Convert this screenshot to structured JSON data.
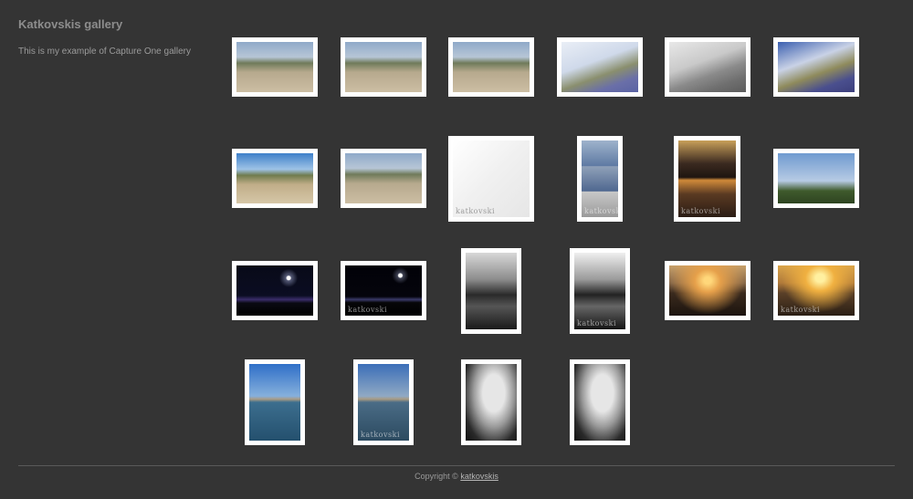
{
  "header": {
    "title": "Katkovskis gallery",
    "description": "This is my example of Capture One gallery"
  },
  "thumbnails": [
    {
      "id": 1,
      "watermark": ""
    },
    {
      "id": 2,
      "watermark": ""
    },
    {
      "id": 3,
      "watermark": ""
    },
    {
      "id": 4,
      "watermark": ""
    },
    {
      "id": 5,
      "watermark": ""
    },
    {
      "id": 6,
      "watermark": ""
    },
    {
      "id": 7,
      "watermark": ""
    },
    {
      "id": 8,
      "watermark": ""
    },
    {
      "id": 9,
      "watermark": "katkovski"
    },
    {
      "id": 10,
      "watermark": "katkovski"
    },
    {
      "id": 11,
      "watermark": "katkovski"
    },
    {
      "id": 12,
      "watermark": ""
    },
    {
      "id": 13,
      "watermark": ""
    },
    {
      "id": 14,
      "watermark": "katkovski"
    },
    {
      "id": 15,
      "watermark": ""
    },
    {
      "id": 16,
      "watermark": "katkovski"
    },
    {
      "id": 17,
      "watermark": ""
    },
    {
      "id": 18,
      "watermark": "katkovski"
    },
    {
      "id": 19,
      "watermark": ""
    },
    {
      "id": 20,
      "watermark": "katkovski"
    },
    {
      "id": 21,
      "watermark": ""
    },
    {
      "id": 22,
      "watermark": ""
    }
  ],
  "footer": {
    "copyright_prefix": "Copyright ©",
    "author_link": "katkovskis"
  }
}
